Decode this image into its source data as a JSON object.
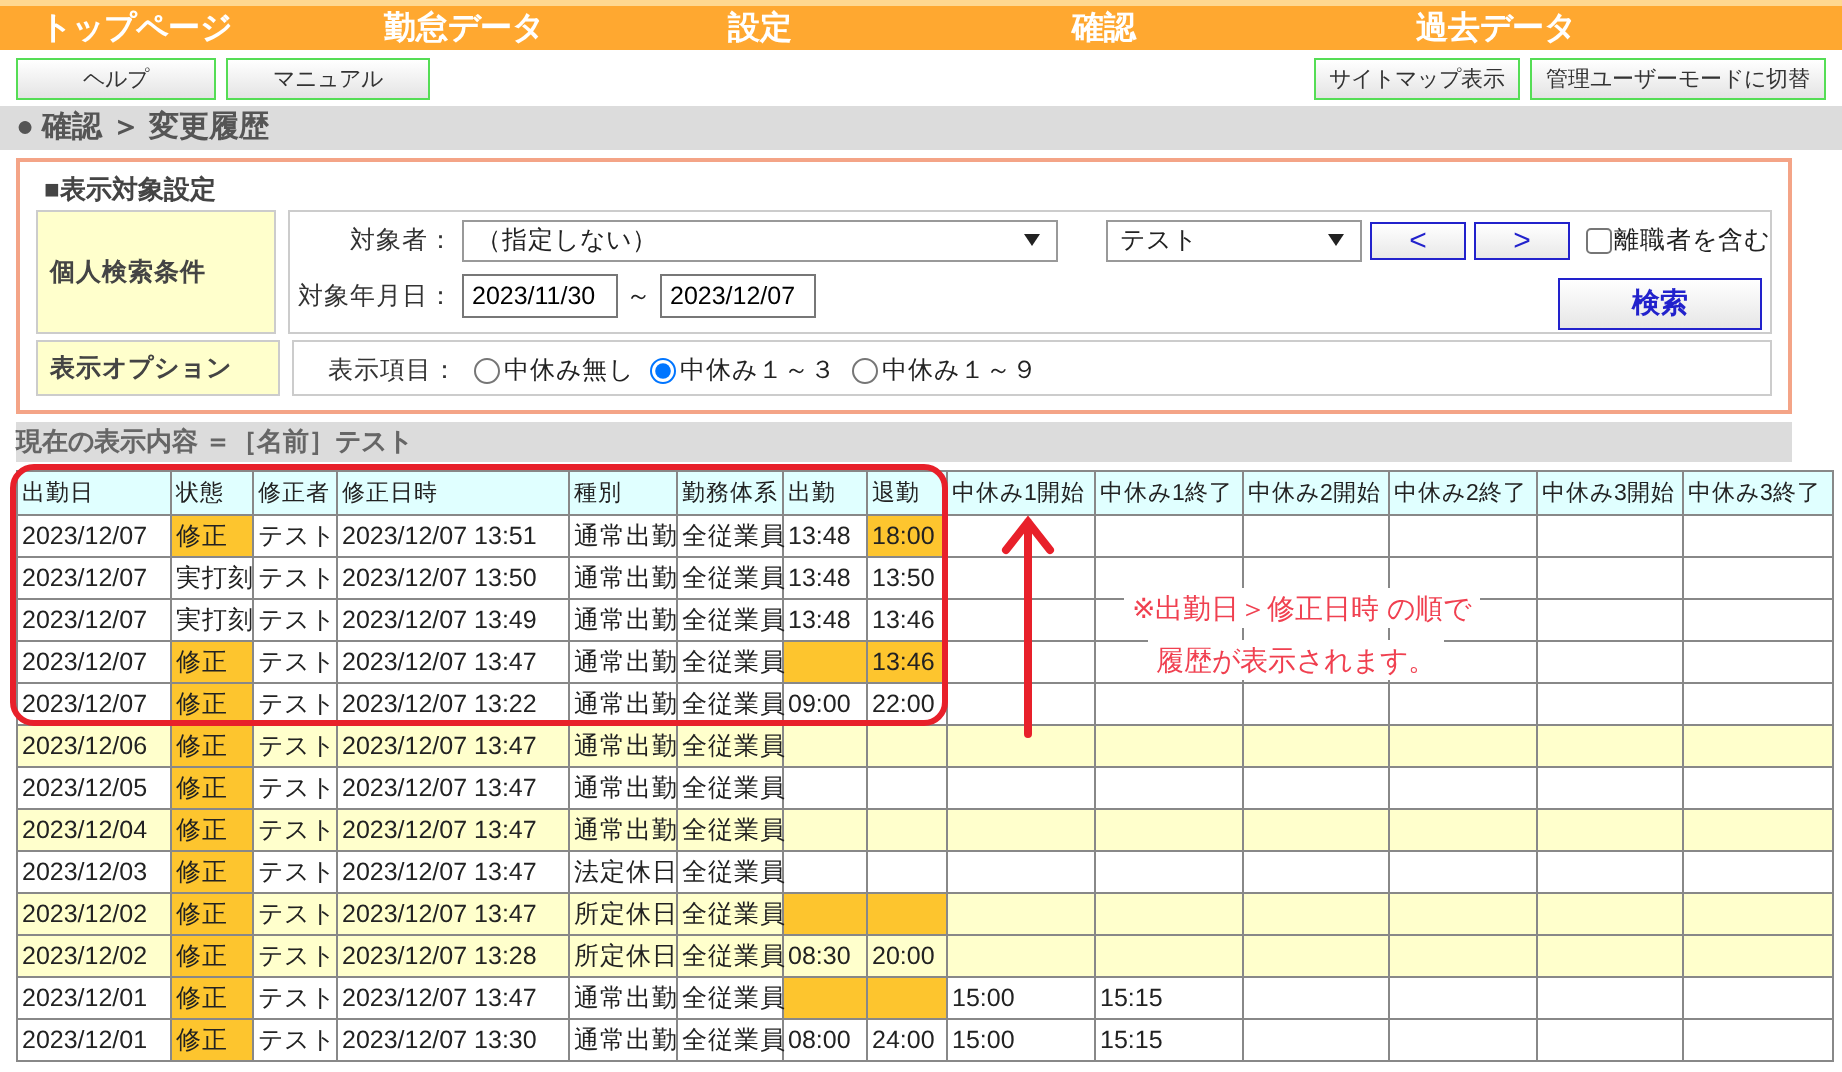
{
  "nav": [
    {
      "label": "トップページ"
    },
    {
      "label": "勤怠データ"
    },
    {
      "label": "設定"
    },
    {
      "label": "確認"
    },
    {
      "label": "過去データ"
    }
  ],
  "buttons_left": [
    "ヘルプ",
    "マニュアル"
  ],
  "buttons_right": [
    "サイトマップ表示",
    "管理ユーザーモードに切替"
  ],
  "breadcrumb": "● 確認 ＞ 変更履歴",
  "settings": {
    "title": "■表示対象設定",
    "search": {
      "label": "個人検索条件",
      "target_label": "対象者：",
      "target_value": "（指定しない）",
      "group_value": "テスト",
      "prev": "<",
      "next": ">",
      "retired": {
        "label": "離職者を含む",
        "checked": false
      },
      "date_label": "対象年月日：",
      "date_from": "2023/11/30",
      "date_sep": "～",
      "date_to": "2023/12/07",
      "search_button": "検索"
    },
    "options": {
      "label": "表示オプション",
      "items_label": "表示項目：",
      "radios": [
        {
          "label": "中休み無し",
          "selected": false
        },
        {
          "label": "中休み１～３",
          "selected": true
        },
        {
          "label": "中休み１～９",
          "selected": false
        }
      ]
    }
  },
  "current": "現在の表示内容 ＝［名前］テスト",
  "table": {
    "columns": [
      "出勤日",
      "状態",
      "修正者",
      "修正日時",
      "種別",
      "勤務体系",
      "出勤",
      "退勤",
      "中休み1開始",
      "中休み1終了",
      "中休み2開始",
      "中休み2終了",
      "中休み3開始",
      "中休み3終了"
    ],
    "rows": [
      {
        "shaded": false,
        "cells": [
          {
            "text": "2023/12/07",
            "highlight": false
          },
          {
            "text": "修正",
            "highlight": true
          },
          {
            "text": "テスト",
            "highlight": false
          },
          {
            "text": "2023/12/07 13:51",
            "highlight": false
          },
          {
            "text": "通常出勤",
            "highlight": false
          },
          {
            "text": "全従業員",
            "highlight": false
          },
          {
            "text": "13:48",
            "highlight": false
          },
          {
            "text": "18:00",
            "highlight": true
          },
          {
            "highlight": false
          },
          {
            "highlight": false
          },
          {
            "highlight": false
          },
          {
            "highlight": false
          },
          {
            "highlight": false
          },
          {
            "highlight": false
          }
        ]
      },
      {
        "shaded": false,
        "cells": [
          {
            "text": "2023/12/07",
            "highlight": false
          },
          {
            "text": "実打刻",
            "highlight": false
          },
          {
            "text": "テスト",
            "highlight": false
          },
          {
            "text": "2023/12/07 13:50",
            "highlight": false
          },
          {
            "text": "通常出勤",
            "highlight": false
          },
          {
            "text": "全従業員",
            "highlight": false
          },
          {
            "text": "13:48",
            "highlight": false
          },
          {
            "text": "13:50",
            "highlight": false
          },
          {
            "highlight": false
          },
          {
            "highlight": false
          },
          {
            "highlight": false
          },
          {
            "highlight": false
          },
          {
            "highlight": false
          },
          {
            "highlight": false
          }
        ]
      },
      {
        "shaded": false,
        "cells": [
          {
            "text": "2023/12/07",
            "highlight": false
          },
          {
            "text": "実打刻",
            "highlight": false
          },
          {
            "text": "テスト",
            "highlight": false
          },
          {
            "text": "2023/12/07 13:49",
            "highlight": false
          },
          {
            "text": "通常出勤",
            "highlight": false
          },
          {
            "text": "全従業員",
            "highlight": false
          },
          {
            "text": "13:48",
            "highlight": false
          },
          {
            "text": "13:46",
            "highlight": false
          },
          {
            "highlight": false
          },
          {
            "highlight": false
          },
          {
            "highlight": false
          },
          {
            "highlight": false
          },
          {
            "highlight": false
          },
          {
            "highlight": false
          }
        ]
      },
      {
        "shaded": false,
        "cells": [
          {
            "text": "2023/12/07",
            "highlight": false
          },
          {
            "text": "修正",
            "highlight": true
          },
          {
            "text": "テスト",
            "highlight": false
          },
          {
            "text": "2023/12/07 13:47",
            "highlight": false
          },
          {
            "text": "通常出勤",
            "highlight": false
          },
          {
            "text": "全従業員",
            "highlight": false
          },
          {
            "highlight": true
          },
          {
            "text": "13:46",
            "highlight": true
          },
          {
            "highlight": false
          },
          {
            "highlight": false
          },
          {
            "highlight": false
          },
          {
            "highlight": false
          },
          {
            "highlight": false
          },
          {
            "highlight": false
          }
        ]
      },
      {
        "shaded": false,
        "cells": [
          {
            "text": "2023/12/07",
            "highlight": false
          },
          {
            "text": "修正",
            "highlight": true
          },
          {
            "text": "テスト",
            "highlight": false
          },
          {
            "text": "2023/12/07 13:22",
            "highlight": false
          },
          {
            "text": "通常出勤",
            "highlight": false
          },
          {
            "text": "全従業員",
            "highlight": false
          },
          {
            "text": "09:00",
            "highlight": false
          },
          {
            "text": "22:00",
            "highlight": false
          },
          {
            "highlight": false
          },
          {
            "highlight": false
          },
          {
            "highlight": false
          },
          {
            "highlight": false
          },
          {
            "highlight": false
          },
          {
            "highlight": false
          }
        ]
      },
      {
        "shaded": true,
        "cells": [
          {
            "text": "2023/12/06",
            "highlight": false
          },
          {
            "text": "修正",
            "highlight": true
          },
          {
            "text": "テスト",
            "highlight": false
          },
          {
            "text": "2023/12/07 13:47",
            "highlight": false
          },
          {
            "text": "通常出勤",
            "highlight": false
          },
          {
            "text": "全従業員",
            "highlight": false
          },
          {
            "highlight": false
          },
          {
            "highlight": false
          },
          {
            "highlight": false
          },
          {
            "highlight": false
          },
          {
            "highlight": false
          },
          {
            "highlight": false
          },
          {
            "highlight": false
          },
          {
            "highlight": false
          }
        ]
      },
      {
        "shaded": false,
        "cells": [
          {
            "text": "2023/12/05",
            "highlight": false
          },
          {
            "text": "修正",
            "highlight": true
          },
          {
            "text": "テスト",
            "highlight": false
          },
          {
            "text": "2023/12/07 13:47",
            "highlight": false
          },
          {
            "text": "通常出勤",
            "highlight": false
          },
          {
            "text": "全従業員",
            "highlight": false
          },
          {
            "highlight": false
          },
          {
            "highlight": false
          },
          {
            "highlight": false
          },
          {
            "highlight": false
          },
          {
            "highlight": false
          },
          {
            "highlight": false
          },
          {
            "highlight": false
          },
          {
            "highlight": false
          }
        ]
      },
      {
        "shaded": true,
        "cells": [
          {
            "text": "2023/12/04",
            "highlight": false
          },
          {
            "text": "修正",
            "highlight": true
          },
          {
            "text": "テスト",
            "highlight": false
          },
          {
            "text": "2023/12/07 13:47",
            "highlight": false
          },
          {
            "text": "通常出勤",
            "highlight": false
          },
          {
            "text": "全従業員",
            "highlight": false
          },
          {
            "highlight": false
          },
          {
            "highlight": false
          },
          {
            "highlight": false
          },
          {
            "highlight": false
          },
          {
            "highlight": false
          },
          {
            "highlight": false
          },
          {
            "highlight": false
          },
          {
            "highlight": false
          }
        ]
      },
      {
        "shaded": false,
        "cells": [
          {
            "text": "2023/12/03",
            "highlight": false
          },
          {
            "text": "修正",
            "highlight": true
          },
          {
            "text": "テスト",
            "highlight": false
          },
          {
            "text": "2023/12/07 13:47",
            "highlight": false
          },
          {
            "text": "法定休日",
            "highlight": false
          },
          {
            "text": "全従業員",
            "highlight": false
          },
          {
            "highlight": false
          },
          {
            "highlight": false
          },
          {
            "highlight": false
          },
          {
            "highlight": false
          },
          {
            "highlight": false
          },
          {
            "highlight": false
          },
          {
            "highlight": false
          },
          {
            "highlight": false
          }
        ]
      },
      {
        "shaded": true,
        "cells": [
          {
            "text": "2023/12/02",
            "highlight": false
          },
          {
            "text": "修正",
            "highlight": true
          },
          {
            "text": "テスト",
            "highlight": false
          },
          {
            "text": "2023/12/07 13:47",
            "highlight": false
          },
          {
            "text": "所定休日",
            "highlight": false
          },
          {
            "text": "全従業員",
            "highlight": false
          },
          {
            "highlight": true
          },
          {
            "highlight": true
          },
          {
            "highlight": false
          },
          {
            "highlight": false
          },
          {
            "highlight": false
          },
          {
            "highlight": false
          },
          {
            "highlight": false
          },
          {
            "highlight": false
          }
        ]
      },
      {
        "shaded": true,
        "cells": [
          {
            "text": "2023/12/02",
            "highlight": false
          },
          {
            "text": "修正",
            "highlight": true
          },
          {
            "text": "テスト",
            "highlight": false
          },
          {
            "text": "2023/12/07 13:28",
            "highlight": false
          },
          {
            "text": "所定休日",
            "highlight": false
          },
          {
            "text": "全従業員",
            "highlight": false
          },
          {
            "text": "08:30",
            "highlight": false
          },
          {
            "text": "20:00",
            "highlight": false
          },
          {
            "highlight": false
          },
          {
            "highlight": false
          },
          {
            "highlight": false
          },
          {
            "highlight": false
          },
          {
            "highlight": false
          },
          {
            "highlight": false
          }
        ]
      },
      {
        "shaded": false,
        "cells": [
          {
            "text": "2023/12/01",
            "highlight": false
          },
          {
            "text": "修正",
            "highlight": true
          },
          {
            "text": "テスト",
            "highlight": false
          },
          {
            "text": "2023/12/07 13:47",
            "highlight": false
          },
          {
            "text": "通常出勤",
            "highlight": false
          },
          {
            "text": "全従業員",
            "highlight": false
          },
          {
            "highlight": true
          },
          {
            "highlight": true
          },
          {
            "text": "15:00",
            "highlight": false
          },
          {
            "text": "15:15",
            "highlight": false
          },
          {
            "highlight": false
          },
          {
            "highlight": false
          },
          {
            "highlight": false
          },
          {
            "highlight": false
          }
        ]
      },
      {
        "shaded": false,
        "cells": [
          {
            "text": "2023/12/01",
            "highlight": false
          },
          {
            "text": "修正",
            "highlight": true
          },
          {
            "text": "テスト",
            "highlight": false
          },
          {
            "text": "2023/12/07 13:30",
            "highlight": false
          },
          {
            "text": "通常出勤",
            "highlight": false
          },
          {
            "text": "全従業員",
            "highlight": false
          },
          {
            "text": "08:00",
            "highlight": false
          },
          {
            "text": "24:00",
            "highlight": false
          },
          {
            "text": "15:00",
            "highlight": false
          },
          {
            "text": "15:15",
            "highlight": false
          },
          {
            "highlight": false
          },
          {
            "highlight": false
          },
          {
            "highlight": false
          },
          {
            "highlight": false
          }
        ]
      }
    ]
  },
  "annotation": {
    "lines": [
      "※出勤日＞修正日時 の順で",
      "履歴が表示されます。"
    ]
  }
}
